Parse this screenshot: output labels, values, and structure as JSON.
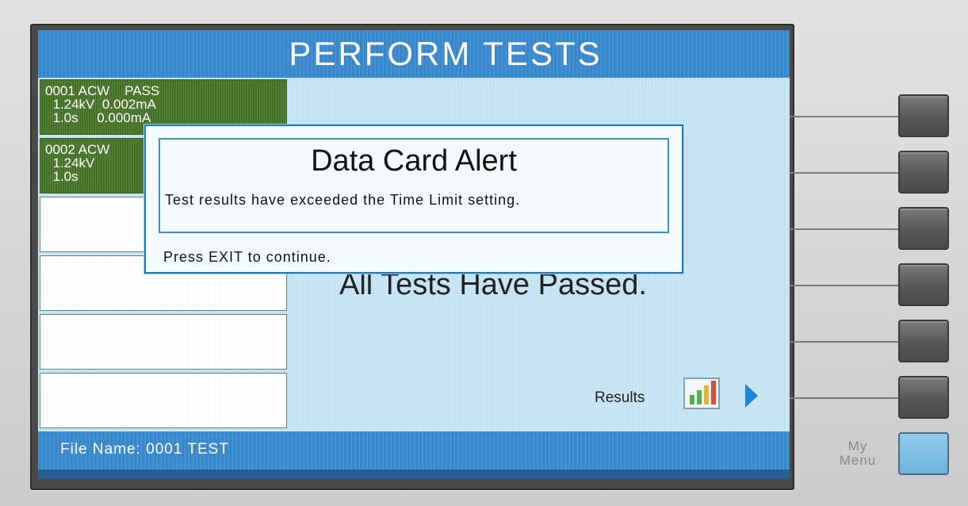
{
  "screen": {
    "title": "PERFORM TESTS",
    "status_message": "All Tests Have Passed.",
    "results_label": "Results",
    "footer": "File Name:  0001  TEST"
  },
  "tests": [
    {
      "line1": "0001 ACW    PASS",
      "line2": "  1.24kV  0.002mA",
      "line3": "  1.0s     0.000mA"
    },
    {
      "line1": "0002 ACW",
      "line2": "  1.24kV",
      "line3": "  1.0s"
    }
  ],
  "dialog": {
    "title": "Data Card Alert",
    "message": "Test results have exceeded the Time Limit setting.",
    "hint": "Press EXIT to continue."
  },
  "side_panel": {
    "menu_label_line1": "My",
    "menu_label_line2": "Menu"
  },
  "colors": {
    "header_blue": "#3a8ad0",
    "pass_green": "#4b7a2a",
    "content_bg": "#c8e6f5",
    "menu_key": "#7fc0e4"
  },
  "icons": {
    "results": "bar-chart-icon",
    "next": "triangle-right-icon"
  }
}
